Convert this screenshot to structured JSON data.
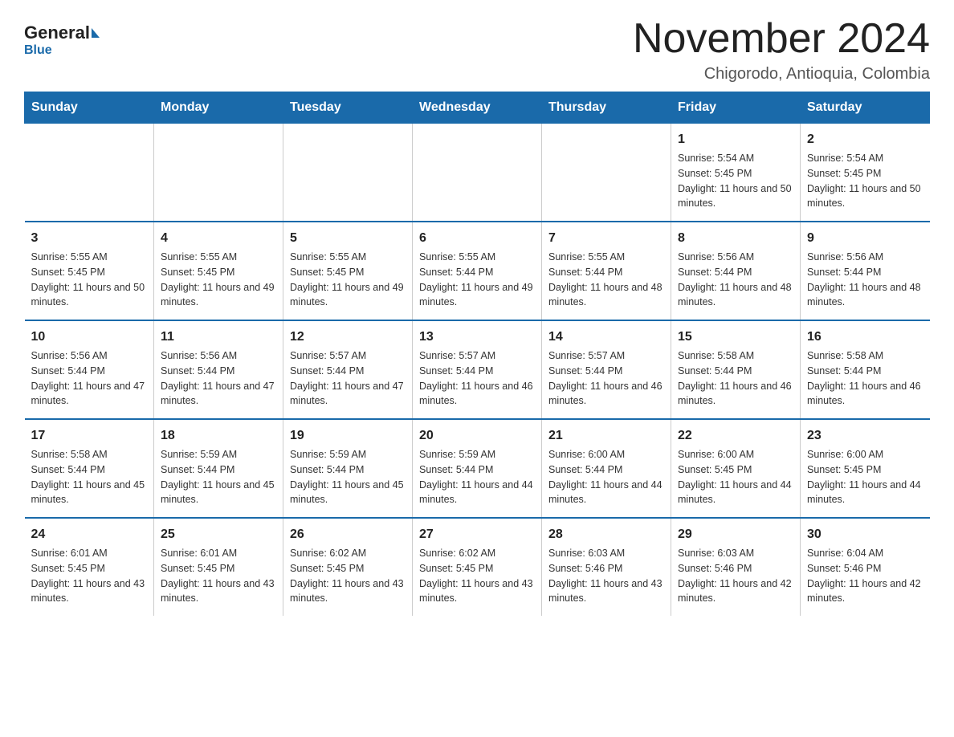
{
  "header": {
    "logo_general": "General",
    "logo_blue": "Blue",
    "title": "November 2024",
    "location": "Chigorodo, Antioquia, Colombia"
  },
  "days_of_week": [
    "Sunday",
    "Monday",
    "Tuesday",
    "Wednesday",
    "Thursday",
    "Friday",
    "Saturday"
  ],
  "weeks": [
    [
      {
        "day": "",
        "info": ""
      },
      {
        "day": "",
        "info": ""
      },
      {
        "day": "",
        "info": ""
      },
      {
        "day": "",
        "info": ""
      },
      {
        "day": "",
        "info": ""
      },
      {
        "day": "1",
        "info": "Sunrise: 5:54 AM\nSunset: 5:45 PM\nDaylight: 11 hours and 50 minutes."
      },
      {
        "day": "2",
        "info": "Sunrise: 5:54 AM\nSunset: 5:45 PM\nDaylight: 11 hours and 50 minutes."
      }
    ],
    [
      {
        "day": "3",
        "info": "Sunrise: 5:55 AM\nSunset: 5:45 PM\nDaylight: 11 hours and 50 minutes."
      },
      {
        "day": "4",
        "info": "Sunrise: 5:55 AM\nSunset: 5:45 PM\nDaylight: 11 hours and 49 minutes."
      },
      {
        "day": "5",
        "info": "Sunrise: 5:55 AM\nSunset: 5:45 PM\nDaylight: 11 hours and 49 minutes."
      },
      {
        "day": "6",
        "info": "Sunrise: 5:55 AM\nSunset: 5:44 PM\nDaylight: 11 hours and 49 minutes."
      },
      {
        "day": "7",
        "info": "Sunrise: 5:55 AM\nSunset: 5:44 PM\nDaylight: 11 hours and 48 minutes."
      },
      {
        "day": "8",
        "info": "Sunrise: 5:56 AM\nSunset: 5:44 PM\nDaylight: 11 hours and 48 minutes."
      },
      {
        "day": "9",
        "info": "Sunrise: 5:56 AM\nSunset: 5:44 PM\nDaylight: 11 hours and 48 minutes."
      }
    ],
    [
      {
        "day": "10",
        "info": "Sunrise: 5:56 AM\nSunset: 5:44 PM\nDaylight: 11 hours and 47 minutes."
      },
      {
        "day": "11",
        "info": "Sunrise: 5:56 AM\nSunset: 5:44 PM\nDaylight: 11 hours and 47 minutes."
      },
      {
        "day": "12",
        "info": "Sunrise: 5:57 AM\nSunset: 5:44 PM\nDaylight: 11 hours and 47 minutes."
      },
      {
        "day": "13",
        "info": "Sunrise: 5:57 AM\nSunset: 5:44 PM\nDaylight: 11 hours and 46 minutes."
      },
      {
        "day": "14",
        "info": "Sunrise: 5:57 AM\nSunset: 5:44 PM\nDaylight: 11 hours and 46 minutes."
      },
      {
        "day": "15",
        "info": "Sunrise: 5:58 AM\nSunset: 5:44 PM\nDaylight: 11 hours and 46 minutes."
      },
      {
        "day": "16",
        "info": "Sunrise: 5:58 AM\nSunset: 5:44 PM\nDaylight: 11 hours and 46 minutes."
      }
    ],
    [
      {
        "day": "17",
        "info": "Sunrise: 5:58 AM\nSunset: 5:44 PM\nDaylight: 11 hours and 45 minutes."
      },
      {
        "day": "18",
        "info": "Sunrise: 5:59 AM\nSunset: 5:44 PM\nDaylight: 11 hours and 45 minutes."
      },
      {
        "day": "19",
        "info": "Sunrise: 5:59 AM\nSunset: 5:44 PM\nDaylight: 11 hours and 45 minutes."
      },
      {
        "day": "20",
        "info": "Sunrise: 5:59 AM\nSunset: 5:44 PM\nDaylight: 11 hours and 44 minutes."
      },
      {
        "day": "21",
        "info": "Sunrise: 6:00 AM\nSunset: 5:44 PM\nDaylight: 11 hours and 44 minutes."
      },
      {
        "day": "22",
        "info": "Sunrise: 6:00 AM\nSunset: 5:45 PM\nDaylight: 11 hours and 44 minutes."
      },
      {
        "day": "23",
        "info": "Sunrise: 6:00 AM\nSunset: 5:45 PM\nDaylight: 11 hours and 44 minutes."
      }
    ],
    [
      {
        "day": "24",
        "info": "Sunrise: 6:01 AM\nSunset: 5:45 PM\nDaylight: 11 hours and 43 minutes."
      },
      {
        "day": "25",
        "info": "Sunrise: 6:01 AM\nSunset: 5:45 PM\nDaylight: 11 hours and 43 minutes."
      },
      {
        "day": "26",
        "info": "Sunrise: 6:02 AM\nSunset: 5:45 PM\nDaylight: 11 hours and 43 minutes."
      },
      {
        "day": "27",
        "info": "Sunrise: 6:02 AM\nSunset: 5:45 PM\nDaylight: 11 hours and 43 minutes."
      },
      {
        "day": "28",
        "info": "Sunrise: 6:03 AM\nSunset: 5:46 PM\nDaylight: 11 hours and 43 minutes."
      },
      {
        "day": "29",
        "info": "Sunrise: 6:03 AM\nSunset: 5:46 PM\nDaylight: 11 hours and 42 minutes."
      },
      {
        "day": "30",
        "info": "Sunrise: 6:04 AM\nSunset: 5:46 PM\nDaylight: 11 hours and 42 minutes."
      }
    ]
  ]
}
